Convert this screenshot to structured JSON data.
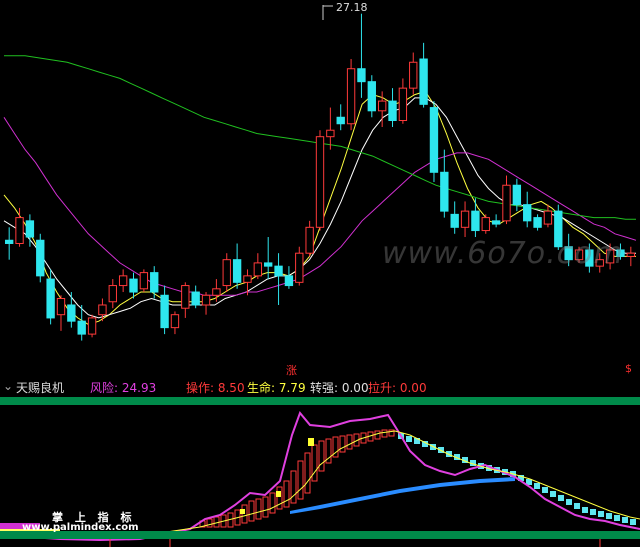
{
  "chart_data": {
    "type": "candlestick",
    "peak_label": "27.18",
    "candles": [
      [
        20.2,
        20.6,
        19.6,
        20.1
      ],
      [
        20.1,
        21.2,
        20.0,
        20.9
      ],
      [
        20.8,
        21.0,
        20.0,
        20.3
      ],
      [
        20.2,
        20.4,
        18.9,
        19.1
      ],
      [
        19.0,
        19.3,
        17.6,
        17.8
      ],
      [
        17.9,
        18.5,
        17.4,
        18.4
      ],
      [
        18.2,
        18.6,
        17.5,
        17.7
      ],
      [
        17.7,
        18.2,
        17.1,
        17.3
      ],
      [
        17.3,
        17.9,
        17.2,
        17.8
      ],
      [
        17.9,
        18.4,
        17.7,
        18.2
      ],
      [
        18.3,
        19.0,
        18.1,
        18.8
      ],
      [
        18.8,
        19.3,
        18.6,
        19.1
      ],
      [
        19.0,
        19.2,
        18.4,
        18.6
      ],
      [
        18.7,
        19.3,
        18.6,
        19.2
      ],
      [
        19.2,
        19.4,
        18.4,
        18.6
      ],
      [
        18.5,
        18.8,
        17.3,
        17.5
      ],
      [
        17.5,
        18.0,
        17.3,
        17.9
      ],
      [
        18.1,
        18.9,
        17.8,
        18.8
      ],
      [
        18.6,
        18.8,
        18.1,
        18.2
      ],
      [
        18.2,
        18.6,
        17.9,
        18.5
      ],
      [
        18.5,
        19.0,
        18.3,
        18.7
      ],
      [
        18.8,
        19.8,
        18.6,
        19.6
      ],
      [
        19.6,
        20.1,
        18.7,
        18.9
      ],
      [
        18.9,
        19.3,
        18.5,
        19.1
      ],
      [
        19.1,
        19.8,
        19.0,
        19.5
      ],
      [
        19.5,
        20.3,
        19.0,
        19.4
      ],
      [
        19.4,
        19.8,
        18.2,
        19.1
      ],
      [
        19.1,
        19.4,
        18.7,
        18.8
      ],
      [
        18.9,
        20.0,
        18.8,
        19.8
      ],
      [
        19.8,
        20.8,
        19.7,
        20.6
      ],
      [
        20.6,
        23.6,
        20.5,
        23.4
      ],
      [
        23.4,
        24.3,
        23.0,
        23.6
      ],
      [
        24.0,
        24.4,
        23.6,
        23.8
      ],
      [
        23.8,
        25.8,
        23.6,
        25.5
      ],
      [
        25.5,
        27.2,
        24.6,
        25.1
      ],
      [
        25.1,
        25.3,
        24.0,
        24.2
      ],
      [
        24.2,
        24.8,
        23.7,
        24.5
      ],
      [
        24.5,
        24.9,
        23.7,
        23.9
      ],
      [
        23.9,
        25.2,
        23.8,
        24.9
      ],
      [
        24.9,
        26.0,
        24.7,
        25.7
      ],
      [
        25.8,
        26.3,
        24.3,
        24.4
      ],
      [
        24.3,
        24.5,
        22.0,
        22.3
      ],
      [
        22.3,
        23.0,
        20.9,
        21.1
      ],
      [
        21.0,
        21.4,
        20.4,
        20.6
      ],
      [
        20.6,
        21.4,
        20.3,
        21.1
      ],
      [
        21.1,
        21.5,
        20.3,
        20.5
      ],
      [
        20.5,
        21.0,
        20.4,
        20.9
      ],
      [
        20.8,
        21.0,
        20.6,
        20.7
      ],
      [
        20.8,
        22.2,
        20.7,
        21.9
      ],
      [
        21.9,
        22.1,
        21.1,
        21.3
      ],
      [
        21.3,
        21.7,
        20.6,
        20.8
      ],
      [
        20.9,
        21.0,
        20.5,
        20.6
      ],
      [
        20.7,
        21.3,
        20.6,
        21.1
      ],
      [
        21.1,
        21.3,
        19.9,
        20.0
      ],
      [
        20.0,
        20.4,
        19.4,
        19.6
      ],
      [
        19.6,
        20.0,
        19.5,
        19.9
      ],
      [
        19.9,
        20.1,
        19.2,
        19.4
      ],
      [
        19.4,
        19.8,
        19.2,
        19.6
      ],
      [
        19.5,
        20.1,
        19.3,
        19.9
      ],
      [
        19.9,
        20.1,
        19.6,
        19.7
      ],
      [
        19.7,
        20.0,
        19.4,
        19.8
      ]
    ],
    "ma_lines": [
      {
        "color": "#ffff40",
        "values": [
          21.6,
          21.2,
          20.7,
          20.1,
          19.2,
          18.6,
          18.1,
          17.8,
          17.6,
          17.7,
          17.9,
          18.2,
          18.4,
          18.6,
          18.6,
          18.4,
          18.3,
          18.3,
          18.3,
          18.3,
          18.4,
          18.6,
          18.8,
          18.9,
          19.1,
          19.2,
          19.2,
          19.1,
          19.3,
          19.7,
          20.6,
          21.5,
          22.4,
          23.4,
          24.4,
          24.7,
          24.6,
          24.4,
          24.5,
          24.7,
          24.8,
          24.3,
          23.5,
          22.6,
          21.8,
          21.2,
          20.8,
          20.7,
          20.9,
          21.1,
          21.3,
          21.4,
          21.2,
          20.9,
          20.6,
          20.4,
          20.1,
          19.8,
          19.7,
          19.7,
          19.7
        ]
      },
      {
        "color": "#ffffff",
        "values": [
          20.8,
          20.6,
          20.4,
          20.0,
          19.5,
          19.0,
          18.6,
          18.2,
          17.9,
          17.8,
          17.9,
          18.0,
          18.1,
          18.3,
          18.4,
          18.3,
          18.2,
          18.2,
          18.2,
          18.2,
          18.2,
          18.4,
          18.5,
          18.6,
          18.8,
          19.0,
          19.1,
          19.1,
          19.3,
          19.6,
          20.1,
          20.7,
          21.4,
          22.2,
          23.0,
          23.6,
          24.0,
          24.2,
          24.3,
          24.6,
          24.6,
          24.4,
          24.0,
          23.4,
          22.8,
          22.2,
          21.8,
          21.5,
          21.3,
          21.3,
          21.2,
          21.1,
          21.0,
          20.9,
          20.7,
          20.5,
          20.3,
          20.1,
          19.9,
          19.8,
          19.8
        ]
      },
      {
        "color": "#d030d0",
        "values": [
          24.0,
          23.5,
          23.0,
          22.6,
          22.1,
          21.6,
          21.2,
          20.8,
          20.4,
          20.1,
          19.8,
          19.5,
          19.3,
          19.1,
          18.9,
          18.8,
          18.7,
          18.6,
          18.6,
          18.5,
          18.5,
          18.5,
          18.5,
          18.6,
          18.6,
          18.7,
          18.8,
          18.9,
          19.0,
          19.2,
          19.4,
          19.7,
          20.0,
          20.4,
          20.8,
          21.1,
          21.4,
          21.7,
          22.0,
          22.3,
          22.5,
          22.7,
          22.8,
          22.9,
          22.9,
          22.8,
          22.7,
          22.5,
          22.3,
          22.1,
          21.9,
          21.7,
          21.5,
          21.3,
          21.1,
          20.9,
          20.7,
          20.6,
          20.4,
          20.3,
          20.2
        ]
      },
      {
        "color": "#20c020",
        "values": [
          25.9,
          25.9,
          25.9,
          25.85,
          25.8,
          25.75,
          25.7,
          25.6,
          25.5,
          25.4,
          25.3,
          25.2,
          25.05,
          24.9,
          24.75,
          24.6,
          24.45,
          24.3,
          24.15,
          24.0,
          23.9,
          23.8,
          23.7,
          23.6,
          23.5,
          23.45,
          23.4,
          23.35,
          23.3,
          23.25,
          23.2,
          23.15,
          23.1,
          23.0,
          22.9,
          22.8,
          22.65,
          22.5,
          22.35,
          22.2,
          22.05,
          21.9,
          21.8,
          21.7,
          21.6,
          21.5,
          21.4,
          21.35,
          21.3,
          21.25,
          21.2,
          21.15,
          21.1,
          21.05,
          21.0,
          20.95,
          20.9,
          20.9,
          20.9,
          20.85,
          20.85
        ]
      }
    ]
  },
  "main_chart": {
    "watermark": "www.6o7o.com",
    "rise_marker": "涨",
    "s_marker": "$",
    "colors": {
      "up": "#ff3a3a",
      "down": "#2ee6ee"
    }
  },
  "indicator_bar": {
    "name": "天赐良机",
    "fields": [
      {
        "label": "风险: 24.93",
        "color": "#e040e0"
      },
      {
        "label": "操作: 8.50",
        "color": "#ff3a3a"
      },
      {
        "label": "生命: 7.79",
        "color": "#ffff40"
      },
      {
        "label": "转强: 0.00",
        "color": "#e0e0e0"
      },
      {
        "label": "拉升: 0.00",
        "color": "#ff3a3a"
      }
    ]
  },
  "footer": {
    "logo_text": "掌 上 指 标",
    "site_text": "www.palmindex.com"
  }
}
